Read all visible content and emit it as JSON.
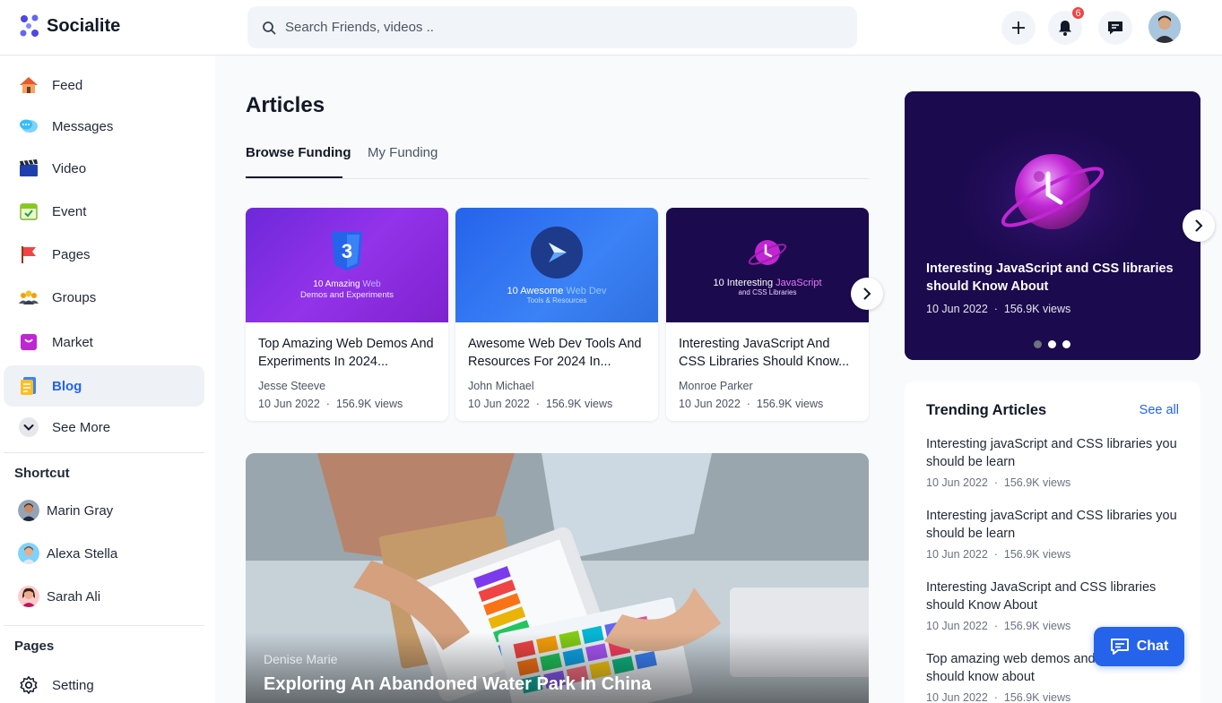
{
  "app": {
    "name": "Socialite"
  },
  "search": {
    "placeholder": "Search Friends, videos .."
  },
  "header": {
    "notification_count": "6"
  },
  "sidebar": {
    "items": [
      {
        "label": "Feed",
        "icon": "home-icon"
      },
      {
        "label": "Messages",
        "icon": "messages-icon"
      },
      {
        "label": "Video",
        "icon": "video-icon"
      },
      {
        "label": "Event",
        "icon": "event-icon"
      },
      {
        "label": "Pages",
        "icon": "flag-icon"
      },
      {
        "label": "Groups",
        "icon": "groups-icon"
      },
      {
        "label": "Market",
        "icon": "market-icon"
      },
      {
        "label": "Blog",
        "icon": "blog-icon"
      },
      {
        "label": "See More",
        "icon": "chevron-down-icon"
      }
    ],
    "active_item": "Blog",
    "shortcut_title": "Shortcut",
    "shortcuts": [
      {
        "name": "Marin Gray"
      },
      {
        "name": "Alexa Stella"
      },
      {
        "name": "Sarah Ali"
      }
    ],
    "pages_title": "Pages",
    "pages_items": [
      {
        "label": "Setting",
        "icon": "gear-icon"
      }
    ]
  },
  "main": {
    "title": "Articles",
    "tabs": [
      {
        "label": "Browse Funding"
      },
      {
        "label": "My Funding"
      }
    ],
    "cards": [
      {
        "image_caption_a": "10 Amazing ",
        "image_caption_b": "Web",
        "image_sub": "Demos and Experiments",
        "title": "Top Amazing Web Demos And Experiments In 2024...",
        "author": "Jesse Steeve",
        "date": "10 Jun 2022",
        "views": "156.9K views"
      },
      {
        "image_caption_a": "10 Awesome ",
        "image_caption_b": "Web Dev",
        "image_sub": "Tools & Resources",
        "title": "Awesome Web Dev Tools And Resources For 2024 In...",
        "author": "John Michael",
        "date": "10 Jun 2022",
        "views": "156.9K views"
      },
      {
        "image_caption_a": "10 Interesting ",
        "image_caption_b": "JavaScript",
        "image_sub": "and CSS Libraries",
        "title": "Interesting JavaScript And CSS Libraries Should Know...",
        "author": "Monroe Parker",
        "date": "10 Jun 2022",
        "views": "156.9K views"
      }
    ],
    "hero": {
      "author": "Denise Marie",
      "title": "Exploring An Abandoned Water Park In China"
    }
  },
  "featured": {
    "title": "Interesting JavaScript and CSS libraries should Know About",
    "date": "10 Jun 2022",
    "views": "156.9K views"
  },
  "trending": {
    "title": "Trending Articles",
    "see_all": "See all",
    "items": [
      {
        "title": "Interesting javaScript and CSS libraries you should be learn",
        "date": "10 Jun 2022",
        "views": "156.9K views"
      },
      {
        "title": "Interesting javaScript and CSS libraries you should be learn",
        "date": "10 Jun 2022",
        "views": "156.9K views"
      },
      {
        "title": "Interesting JavaScript and CSS libraries should Know About",
        "date": "10 Jun 2022",
        "views": "156.9K views"
      },
      {
        "title": "Top amazing web demos and experiments should know about",
        "date": "10 Jun 2022",
        "views": "156.9K views"
      }
    ]
  },
  "chat": {
    "label": "Chat"
  },
  "colors": {
    "accent": "#2563eb",
    "badge": "#ef4444",
    "feature_bg": "#1b0a4e"
  }
}
